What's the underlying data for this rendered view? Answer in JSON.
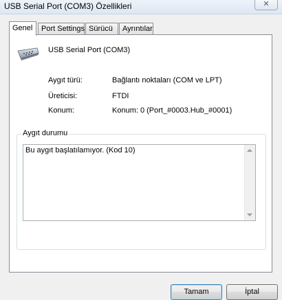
{
  "window": {
    "title": "USB Serial Port (COM3) Özellikleri",
    "close_glyph": "✕"
  },
  "tabs": [
    {
      "label": "Genel",
      "active": true
    },
    {
      "label": "Port Settings",
      "active": false
    },
    {
      "label": "Sürücü",
      "active": false
    },
    {
      "label": "Ayrıntılar",
      "active": false
    }
  ],
  "device": {
    "icon": "serial-port-connector-icon",
    "name": "USB Serial Port (COM3)",
    "properties": [
      {
        "label": "Aygıt türü:",
        "value": "Bağlantı noktaları (COM ve LPT)"
      },
      {
        "label": "Üreticisi:",
        "value": "FTDI"
      },
      {
        "label": "Konum:",
        "value": "Konum: 0 (Port_#0003.Hub_#0001)"
      }
    ]
  },
  "status": {
    "legend": "Aygıt durumu",
    "text": "Bu aygıt başlatılamıyor. (Kod 10)"
  },
  "buttons": {
    "ok": "Tamam",
    "cancel": "İptal"
  }
}
